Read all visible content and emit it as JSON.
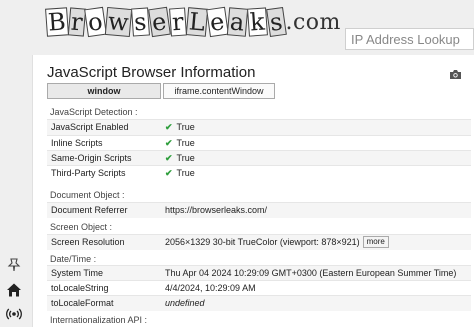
{
  "header": {
    "logo_text": "BrowserLeaks",
    "logo_tail": ".com",
    "search_placeholder": "IP Address Lookup"
  },
  "page": {
    "title": "JavaScript Browser Information",
    "tabs": [
      {
        "label": "window",
        "active": true
      },
      {
        "label": "iframe.contentWindow",
        "active": false
      }
    ]
  },
  "sections": {
    "detection": {
      "label": "JavaScript Detection :",
      "rows": [
        {
          "key": "JavaScript Enabled",
          "value": "True"
        },
        {
          "key": "Inline Scripts",
          "value": "True"
        },
        {
          "key": "Same-Origin Scripts",
          "value": "True"
        },
        {
          "key": "Third-Party Scripts",
          "value": "True"
        }
      ]
    },
    "document": {
      "label": "Document Object :",
      "rows": [
        {
          "key": "Document Referrer",
          "value": "https://browserleaks.com/"
        }
      ]
    },
    "screen": {
      "label": "Screen Object :",
      "rows": [
        {
          "key": "Screen Resolution",
          "value": "2056×1329 30-bit TrueColor (viewport: 878×921)",
          "button": "more"
        }
      ]
    },
    "datetime": {
      "label": "Date/Time :",
      "rows": [
        {
          "key": "System Time",
          "value": "Thu Apr 04 2024 10:29:09 GMT+0300 (Eastern European Summer Time)"
        },
        {
          "key": "toLocaleString",
          "value": "4/4/2024, 10:29:09 AM"
        },
        {
          "key": "toLocaleFormat",
          "value": "undefined"
        }
      ]
    },
    "intl": {
      "label": "Internationalization API :"
    }
  },
  "sidebar": {
    "icons": [
      "pin-icon",
      "home-icon",
      "broadcast-icon"
    ]
  },
  "colors": {
    "check": "#2e9e3c",
    "background": "#efefef"
  }
}
